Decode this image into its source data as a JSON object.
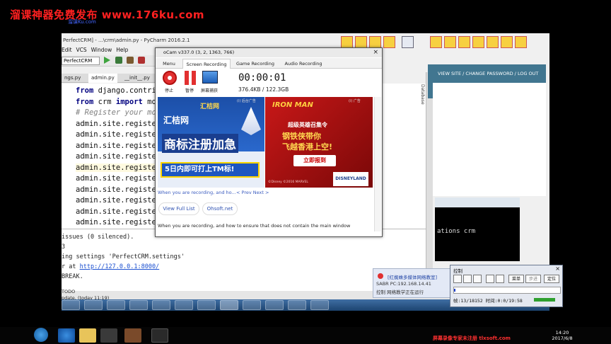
{
  "banner": {
    "title": "溜课神器免费发布  www.176ku.com",
    "sub": "溜课Ku.com"
  },
  "pycharm": {
    "title": "PerfectCRM] - ...\\crm\\admin.py - PyCharm 2016.2.1",
    "menu": [
      "Edit",
      "VCS",
      "Window",
      "Help"
    ],
    "project": "PerfectCRM",
    "tabs": [
      "ngs.py",
      "admin.py",
      "__init__.py"
    ],
    "code": [
      {
        "text": "from django.contrib",
        "kind": "import"
      },
      {
        "text": "from crm import mod",
        "kind": "import"
      },
      {
        "text": "# Register your mod",
        "kind": "comment"
      },
      {
        "text": "admin.site.register",
        "kind": "plain"
      },
      {
        "text": "admin.site.register",
        "kind": "plain"
      },
      {
        "text": "admin.site.register",
        "kind": "plain"
      },
      {
        "text": "admin.site.register",
        "kind": "plain"
      },
      {
        "text": "admin.site.register",
        "kind": "highlight"
      },
      {
        "text": "admin.site.register",
        "kind": "plain"
      },
      {
        "text": "admin.site.register",
        "kind": "plain"
      },
      {
        "text": "admin.site.register",
        "kind": "plain"
      },
      {
        "text": "admin.site.register",
        "kind": "plain"
      },
      {
        "text": "admin.site.register",
        "kind": "plain"
      }
    ],
    "console": {
      "line1": "issues (0 silenced).",
      "line2": "3",
      "line3": "ing settings 'PerfectCRM.settings'",
      "line4_prefix": "r at ",
      "line4_link": "http://127.0.0.1:8000/",
      "line5": "BREAK."
    },
    "status_todo": "TODO",
    "status_update": "pdate. (today 11:19)"
  },
  "admin": {
    "nav": "VIEW SITE / CHANGE PASSWORD / LOG OUT",
    "db_label": "Database"
  },
  "cmd": {
    "text": "ations crm"
  },
  "ocam": {
    "title": "oCam v337.0 (3, 2, 1363, 766)",
    "close": "×",
    "tabs": [
      "Menu",
      "Screen Recording",
      "Game Recording",
      "Audio Recording"
    ],
    "active_tab": 1,
    "controls": {
      "stop": "停止",
      "pause": "暂停",
      "screenshot": "屏幕捕获"
    },
    "timer": "00:00:01",
    "size": "376.4KB / 122.3GB",
    "ad_left": {
      "mark": "(i)  后台广告",
      "brand": "汇桔网",
      "headline": "商标注册加急",
      "strip": "5日内即可打上TM标!"
    },
    "ad_right": {
      "mark": "(i)  广告",
      "brand": "IRON MAN",
      "line1": "超级英雄召集令",
      "line2": "钢铁侠带你",
      "line3": "飞越香港上空!",
      "button": "立即报到",
      "logo": "DISNEYLAND",
      "copyright": "©Disney ©2016 MARVEL"
    },
    "link1": "When you are recording, and ho...",
    "link2": "< Prev  Next >",
    "pills": [
      "View Full List",
      "Ohsoft.net"
    ],
    "footer": "When you are recording, and how to ensure that does not contain the main window"
  },
  "notification": {
    "title": "[红蜘蛛多媒体网络教室]",
    "line1": "SABR   PC:192.168.14.41",
    "line2": "控制   网络教学正在运行"
  },
  "control_panel": {
    "title": "控制",
    "close": "×",
    "menu": "菜单",
    "step": "步进",
    "locate": "定位",
    "progress_fraction": 0.008,
    "status": "帧:13/18152  时间:0:0/19:58"
  },
  "taskbar": {
    "time": "14:20",
    "date": "2017/6/8"
  },
  "watermark": "屏幕录像专家未注册 tlxsoft.com"
}
